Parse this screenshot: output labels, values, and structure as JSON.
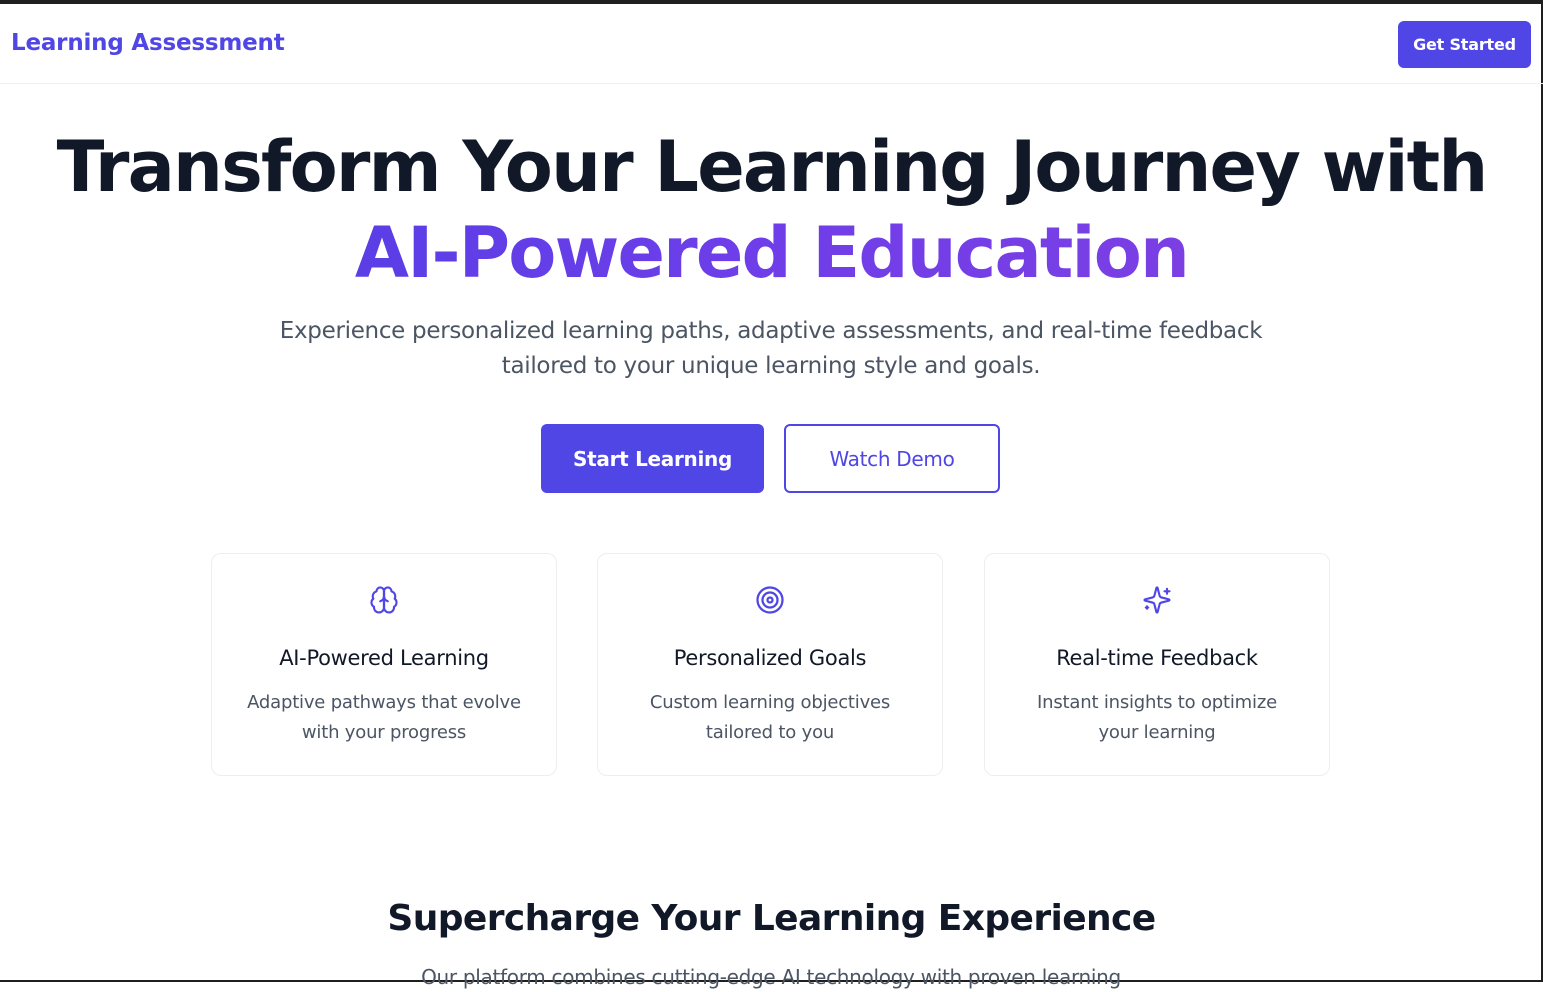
{
  "header": {
    "brand": "Learning Assessment",
    "cta_label": "Get Started"
  },
  "hero": {
    "title_line1": "Transform Your Learning Journey with",
    "title_line2": "AI-Powered Education",
    "subtitle": "Experience personalized learning paths, adaptive assessments, and real-time feedback tailored to your unique learning style and goals.",
    "primary_button": "Start Learning",
    "secondary_button": "Watch Demo"
  },
  "features": [
    {
      "icon": "brain-icon",
      "title": "AI-Powered Learning",
      "description": "Adaptive pathways that evolve with your progress"
    },
    {
      "icon": "target-icon",
      "title": "Personalized Goals",
      "description": "Custom learning objectives tailored to you"
    },
    {
      "icon": "sparkles-icon",
      "title": "Real-time Feedback",
      "description": "Instant insights to optimize your learning"
    }
  ],
  "section": {
    "title": "Supercharge Your Learning Experience",
    "subtitle": "Our platform combines cutting-edge AI technology with proven learning"
  },
  "colors": {
    "accent": "#4f46e5",
    "gradient_start": "#5b3ee6",
    "gradient_end": "#7b3fe4",
    "heading": "#111827",
    "body_text": "#4b5563"
  }
}
